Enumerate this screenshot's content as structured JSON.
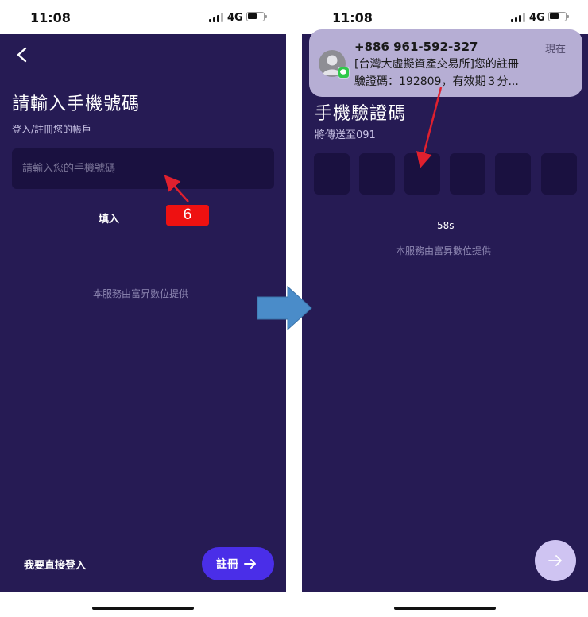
{
  "left": {
    "status": {
      "time": "11:08",
      "network": "4G"
    },
    "title": "請輸入手機號碼",
    "subtitle": "登入/註冊您的帳戶",
    "phone_input": {
      "placeholder": "請輸入您的手機號碼",
      "value": ""
    },
    "annotation": "填入",
    "step_badge": "6",
    "provider": "本服務由富昇數位提供",
    "login_link": "我要直接登入",
    "register_label": "註冊"
  },
  "right": {
    "status": {
      "time": "11:08",
      "network": "4G"
    },
    "title": "手機驗證碼",
    "subtitle": "將傳送至091",
    "code_boxes": [
      "",
      "",
      "",
      "",
      "",
      ""
    ],
    "countdown": "58s",
    "provider": "本服務由富昇數位提供",
    "notification": {
      "sender": "+886 961-592-327",
      "time": "現在",
      "line1": "[台灣大虛擬資產交易所]您的註冊",
      "line2": "驗證碼：192809，有效期３分..."
    }
  },
  "colors": {
    "background": "#261b54",
    "input_bg": "#1a1140",
    "register_button": "#4a2ee8",
    "next_button": "#cfc4f2",
    "step_badge": "#ee1111",
    "annotation_arrow": "#e0202e",
    "transition_arrow": "#4a8cc9",
    "notification_bg": "#b6aed4"
  },
  "icons": {
    "back": "chevron-left-icon",
    "register_arrow": "arrow-right-icon",
    "next": "arrow-right-icon",
    "notification_avatar": "person-avatar-icon",
    "notification_app": "messages-icon",
    "transition": "big-arrow-right-icon"
  }
}
